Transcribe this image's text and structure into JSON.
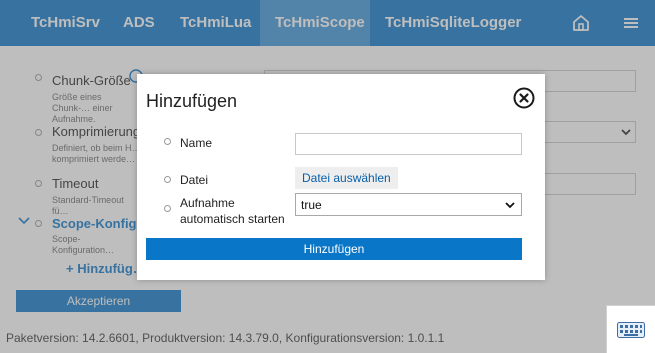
{
  "nav": {
    "tabs": [
      {
        "label": "TcHmiSrv"
      },
      {
        "label": "ADS"
      },
      {
        "label": "TcHmiLua"
      },
      {
        "label": "TcHmiScope",
        "active": true
      },
      {
        "label": "TcHmiSqliteLogger"
      }
    ],
    "home_icon": "home-icon",
    "menu_icon": "hamburger-menu-icon"
  },
  "settings": {
    "chunk_size": {
      "label": "Chunk-Größe",
      "desc": "Größe eines Chunk-… einer Aufnahme."
    },
    "compression": {
      "label": "Komprimierung",
      "desc": "Definiert, ob beim H… komprimiert werde…"
    },
    "timeout": {
      "label": "Timeout",
      "desc": "Standard-Timeout fü…"
    },
    "scope_config": {
      "label": "Scope-Konfigur…",
      "desc": "Scope-Konfiguration…"
    },
    "add_link": "+ Hinzufüg…",
    "accept_button": "Akzeptieren",
    "footer": "Paketversion: 14.2.6601, Produktversion: 14.3.79.0, Konfigurationsversion: 1.0.1.1"
  },
  "dialog": {
    "title": "Hinzufügen",
    "close_icon": "close-circle-icon",
    "name_label": "Name",
    "name_value": "",
    "file_label": "Datei",
    "file_button": "Datei auswählen",
    "autostart_label_line1": "Aufnahme",
    "autostart_label_line2": "automatisch starten",
    "autostart_value": "true",
    "submit_button": "Hinzufügen"
  },
  "keyboard_icon": "keyboard-icon",
  "colors": {
    "primary": "#0a76c8",
    "active_tab": "#3b94d8",
    "overlay": "rgba(110,110,110,0.45)"
  }
}
